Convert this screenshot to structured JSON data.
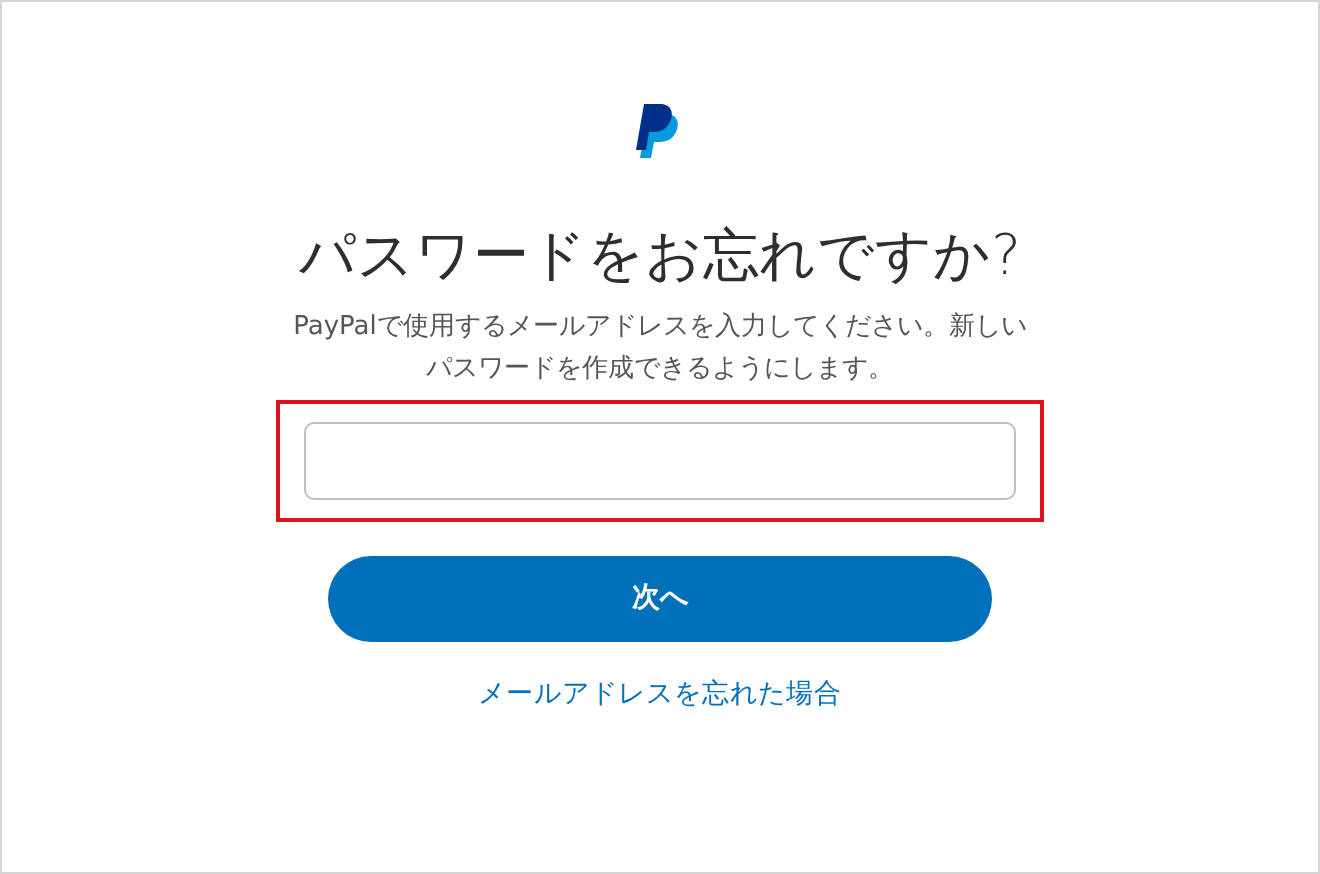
{
  "title": "パスワードをお忘れですか?",
  "description": "PayPalで使用するメールアドレスを入力してください。新しいパスワードを作成できるようにします。",
  "email_field": {
    "highlighted": true
  },
  "next_button": "次へ",
  "forgot_email_link": "メールアドレスを忘れた場合"
}
